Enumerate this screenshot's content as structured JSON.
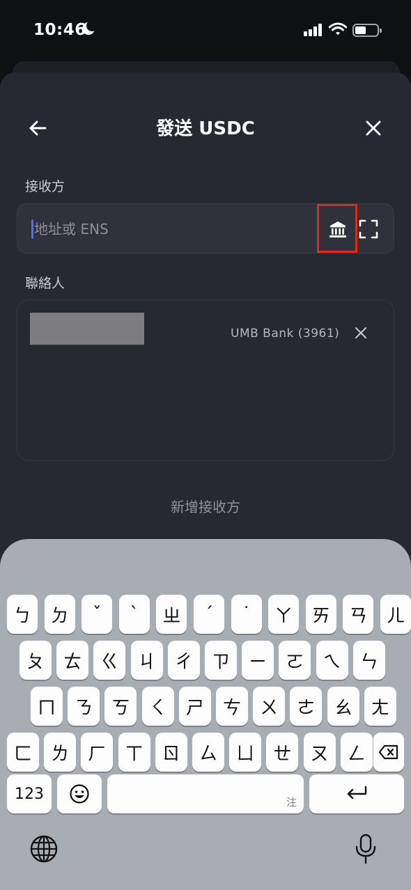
{
  "status": {
    "time": "10:46"
  },
  "header": {
    "title": "發送 USDC"
  },
  "recipient": {
    "label": "接收方",
    "placeholder": "地址或 ENS"
  },
  "contacts": {
    "label": "聯絡人",
    "items": [
      {
        "bank": "UMB Bank (3961)"
      }
    ]
  },
  "add_recipient": "新增接收方",
  "keyboard": {
    "row1": [
      "ㄅ",
      "ㄉ",
      "ˇ",
      "ˋ",
      "ㄓ",
      "ˊ",
      "˙",
      "ㄚ",
      "ㄞ",
      "ㄢ",
      "ㄦ"
    ],
    "row2": [
      "ㄆ",
      "ㄊ",
      "ㄍ",
      "ㄐ",
      "ㄔ",
      "ㄗ",
      "ㄧ",
      "ㄛ",
      "ㄟ",
      "ㄣ"
    ],
    "row3": [
      "ㄇ",
      "ㄋ",
      "ㄎ",
      "ㄑ",
      "ㄕ",
      "ㄘ",
      "ㄨ",
      "ㄜ",
      "ㄠ",
      "ㄤ"
    ],
    "row4": [
      "ㄈ",
      "ㄌ",
      "ㄏ",
      "ㄒ",
      "ㄖ",
      "ㄙ",
      "ㄩ",
      "ㄝ",
      "ㄡ",
      "ㄥ"
    ],
    "numbers_key": "123",
    "space_hint": "注",
    "emoji_key": "emoji-icon",
    "return_key": "return-icon",
    "delete_key": "delete-icon"
  },
  "colors": {
    "highlight": "#e02a18",
    "caret": "#4e6cff",
    "sheet": "#262931"
  }
}
